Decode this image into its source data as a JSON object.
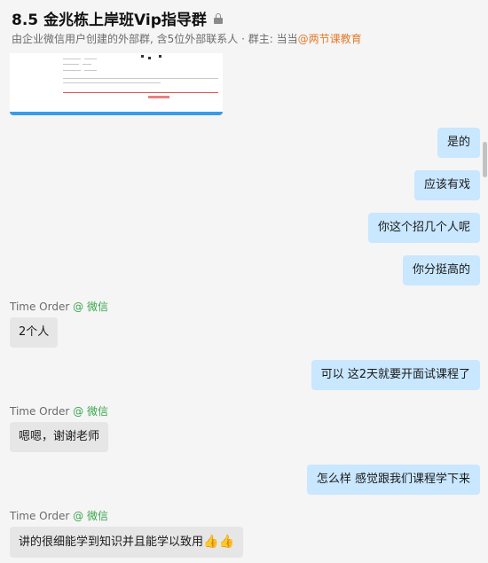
{
  "header": {
    "title": "8.5 金兆栋上岸班Vip指导群",
    "subtitle_prefix": "由企业微信用户创建的外部群, 含5位外部联系人 · 群主: 当当",
    "owner": "@两节课教育"
  },
  "messages": [
    {
      "id": "m1",
      "side": "out",
      "text": "是的"
    },
    {
      "id": "m2",
      "side": "out",
      "text": "应该有戏"
    },
    {
      "id": "m3",
      "side": "out",
      "text": "你这个招几个人呢"
    },
    {
      "id": "m4",
      "side": "out",
      "text": "你分挺高的"
    },
    {
      "id": "m5",
      "side": "in",
      "sender": "Time  Order",
      "source": "@ 微信",
      "text": "2个人"
    },
    {
      "id": "m6",
      "side": "out",
      "text": "可以  这2天就要开面试课程了"
    },
    {
      "id": "m7",
      "side": "in",
      "sender": "Time  Order",
      "source": "@ 微信",
      "text": "嗯嗯，谢谢老师"
    },
    {
      "id": "m8",
      "side": "out",
      "text": "怎么样 感觉跟我们课程学下来"
    },
    {
      "id": "m9",
      "side": "in",
      "sender": "Time  Order",
      "source": "@ 微信",
      "text": "讲的很细能学到知识并且能学以致用"
    }
  ],
  "icons": {
    "lock": "lock-icon",
    "thumbs": "thumbs-up-icon"
  },
  "colors": {
    "outgoing_bubble": "#c9e7ff",
    "incoming_bubble": "#e6e6e6",
    "source_tag": "#3aa64f",
    "owner_tag": "#e47b2c"
  }
}
